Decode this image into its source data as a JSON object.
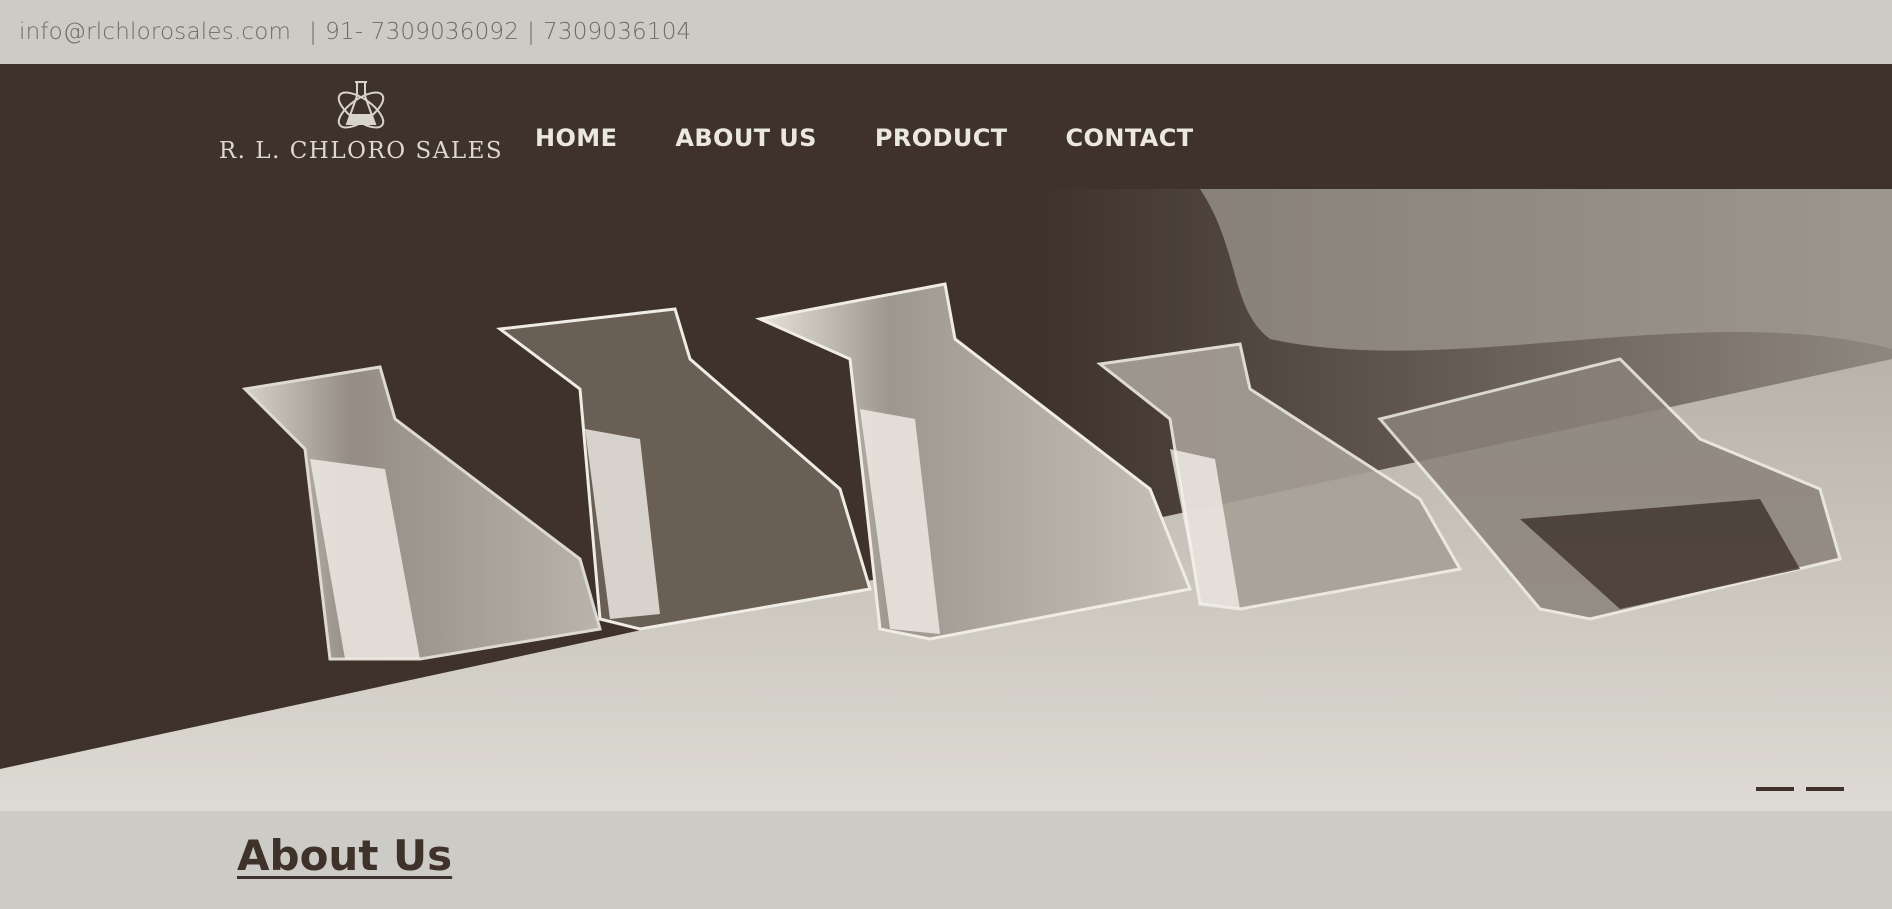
{
  "topbar": {
    "email": "info@rlchlorosales.com",
    "separator": "|",
    "phone_1": "91- 7309036092",
    "phone_2": "7309036104"
  },
  "brand": {
    "name": "R. L. CHLORO SALES",
    "logo_icon": "flask-atom-icon"
  },
  "nav": {
    "items": [
      {
        "label": "HOME"
      },
      {
        "label": "ABOUT US"
      },
      {
        "label": "PRODUCT"
      },
      {
        "label": "CONTACT"
      }
    ]
  },
  "hero": {
    "image": "laboratory-flasks-on-table",
    "slide_count": 2
  },
  "about": {
    "title": "About Us"
  },
  "colors": {
    "dark_brown": "#3e322a",
    "light_gray": "#cdcbc5",
    "nav_text": "#ebe8e1"
  }
}
